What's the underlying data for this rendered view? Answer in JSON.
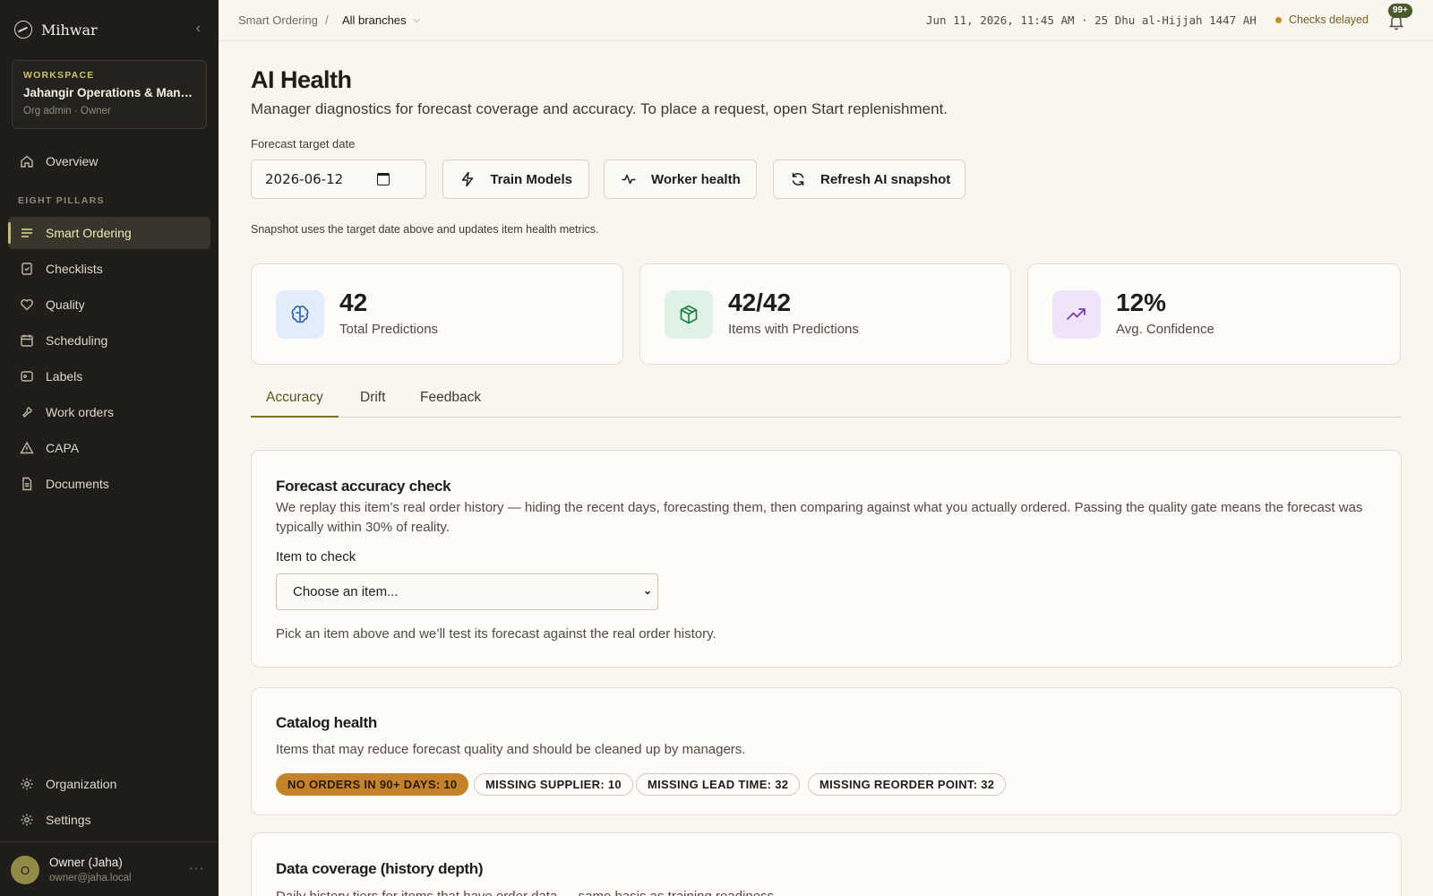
{
  "app": {
    "name": "Mihwar"
  },
  "workspace": {
    "kicker": "WORKSPACE",
    "name": "Jahangir Operations & Manag...",
    "role": "Org admin · Owner"
  },
  "sidebar": {
    "overview": "Overview",
    "section_label": "EIGHT PILLARS",
    "items": [
      {
        "label": "Smart Ordering",
        "icon": "list-icon"
      },
      {
        "label": "Checklists",
        "icon": "clipboard-check-icon"
      },
      {
        "label": "Quality",
        "icon": "heart-icon"
      },
      {
        "label": "Scheduling",
        "icon": "calendar-icon"
      },
      {
        "label": "Labels",
        "icon": "tag-icon"
      },
      {
        "label": "Work orders",
        "icon": "wrench-icon"
      },
      {
        "label": "CAPA",
        "icon": "warning-triangle-icon"
      },
      {
        "label": "Documents",
        "icon": "document-icon"
      }
    ],
    "bottom": {
      "organization": "Organization",
      "settings": "Settings"
    },
    "user": {
      "initial": "O",
      "name": "Owner (Jaha)",
      "email": "owner@jaha.local"
    }
  },
  "topbar": {
    "breadcrumb_root": "Smart Ordering",
    "breadcrumb_sep": "/",
    "branch": "All branches",
    "clock": "Jun 11, 2026, 11:45 AM · 25 Dhu al-Hijjah 1447 AH",
    "status": "Checks delayed",
    "notifications_badge": "99+"
  },
  "page": {
    "title": "AI Health",
    "subtitle": "Manager diagnostics for forecast coverage and accuracy. To place a request, open Start replenishment.",
    "target_label": "Forecast target date",
    "target_value": "2026-06-12",
    "buttons": {
      "train": "Train Models",
      "worker": "Worker health",
      "refresh": "Refresh AI snapshot"
    },
    "snapshot_note": "Snapshot uses the target date above and updates item health metrics."
  },
  "stats": [
    {
      "value": "42",
      "label": "Total Predictions",
      "icon": "brain-icon",
      "color": "#2b5fb0",
      "bg": "#e3ecfb"
    },
    {
      "value": "42/42",
      "label": "Items with Predictions",
      "icon": "package-icon",
      "color": "#1f7a43",
      "bg": "#def3e5"
    },
    {
      "value": "12%",
      "label": "Avg. Confidence",
      "icon": "trending-up-icon",
      "color": "#7a3bb5",
      "bg": "#f0e4fb"
    }
  ],
  "tabs": [
    "Accuracy",
    "Drift",
    "Feedback"
  ],
  "accuracy_card": {
    "title": "Forecast accuracy check",
    "description": "We replay this item’s real order history — hiding the recent days, forecasting them, then comparing against what you actually ordered. Passing the quality gate means the forecast was typically within 30% of reality.",
    "item_label": "Item to check",
    "select_placeholder": "Choose an item...",
    "hint": "Pick an item above and we’ll test its forecast against the real order history."
  },
  "catalog_card": {
    "title": "Catalog health",
    "description": "Items that may reduce forecast quality and should be cleaned up by managers.",
    "pills": [
      "NO ORDERS IN 90+ DAYS: 10",
      "MISSING SUPPLIER: 10",
      "MISSING LEAD TIME: 32",
      "MISSING REORDER POINT: 32"
    ]
  },
  "coverage_card": {
    "title": "Data coverage (history depth)",
    "description": "Daily history tiers for items that have order data — same basis as training readiness."
  }
}
